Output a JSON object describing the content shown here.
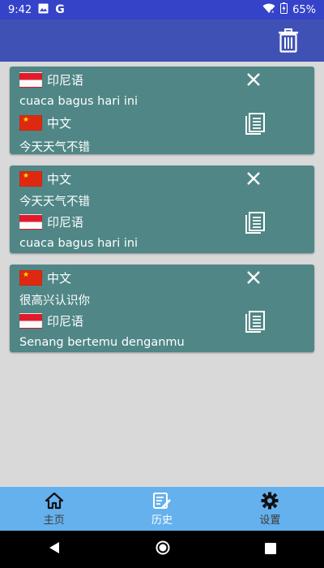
{
  "status_bar": {
    "time": "9:42",
    "battery": "65%",
    "g_letter": "G"
  },
  "app_bar": {
    "accent": "#3f51b5",
    "delete_icon": "trash-icon"
  },
  "history": [
    {
      "source_lang": "印尼语",
      "source_flag": "indonesia",
      "source_text": "cuaca bagus hari ini",
      "target_lang": "中文",
      "target_flag": "china",
      "target_text": "今天天气不错"
    },
    {
      "source_lang": "中文",
      "source_flag": "china",
      "source_text": "今天天气不错",
      "target_lang": "印尼语",
      "target_flag": "indonesia",
      "target_text": "cuaca bagus hari ini"
    },
    {
      "source_lang": "中文",
      "source_flag": "china",
      "source_text": "很高兴认识你",
      "target_lang": "印尼语",
      "target_flag": "indonesia",
      "target_text": "Senang bertemu denganmu"
    }
  ],
  "card_color": "#508686",
  "bottom_nav": {
    "items": [
      {
        "label": "主页",
        "icon": "home-icon"
      },
      {
        "label": "历史",
        "icon": "edit-note-icon",
        "active": true
      },
      {
        "label": "设置",
        "icon": "gear-icon"
      }
    ]
  }
}
